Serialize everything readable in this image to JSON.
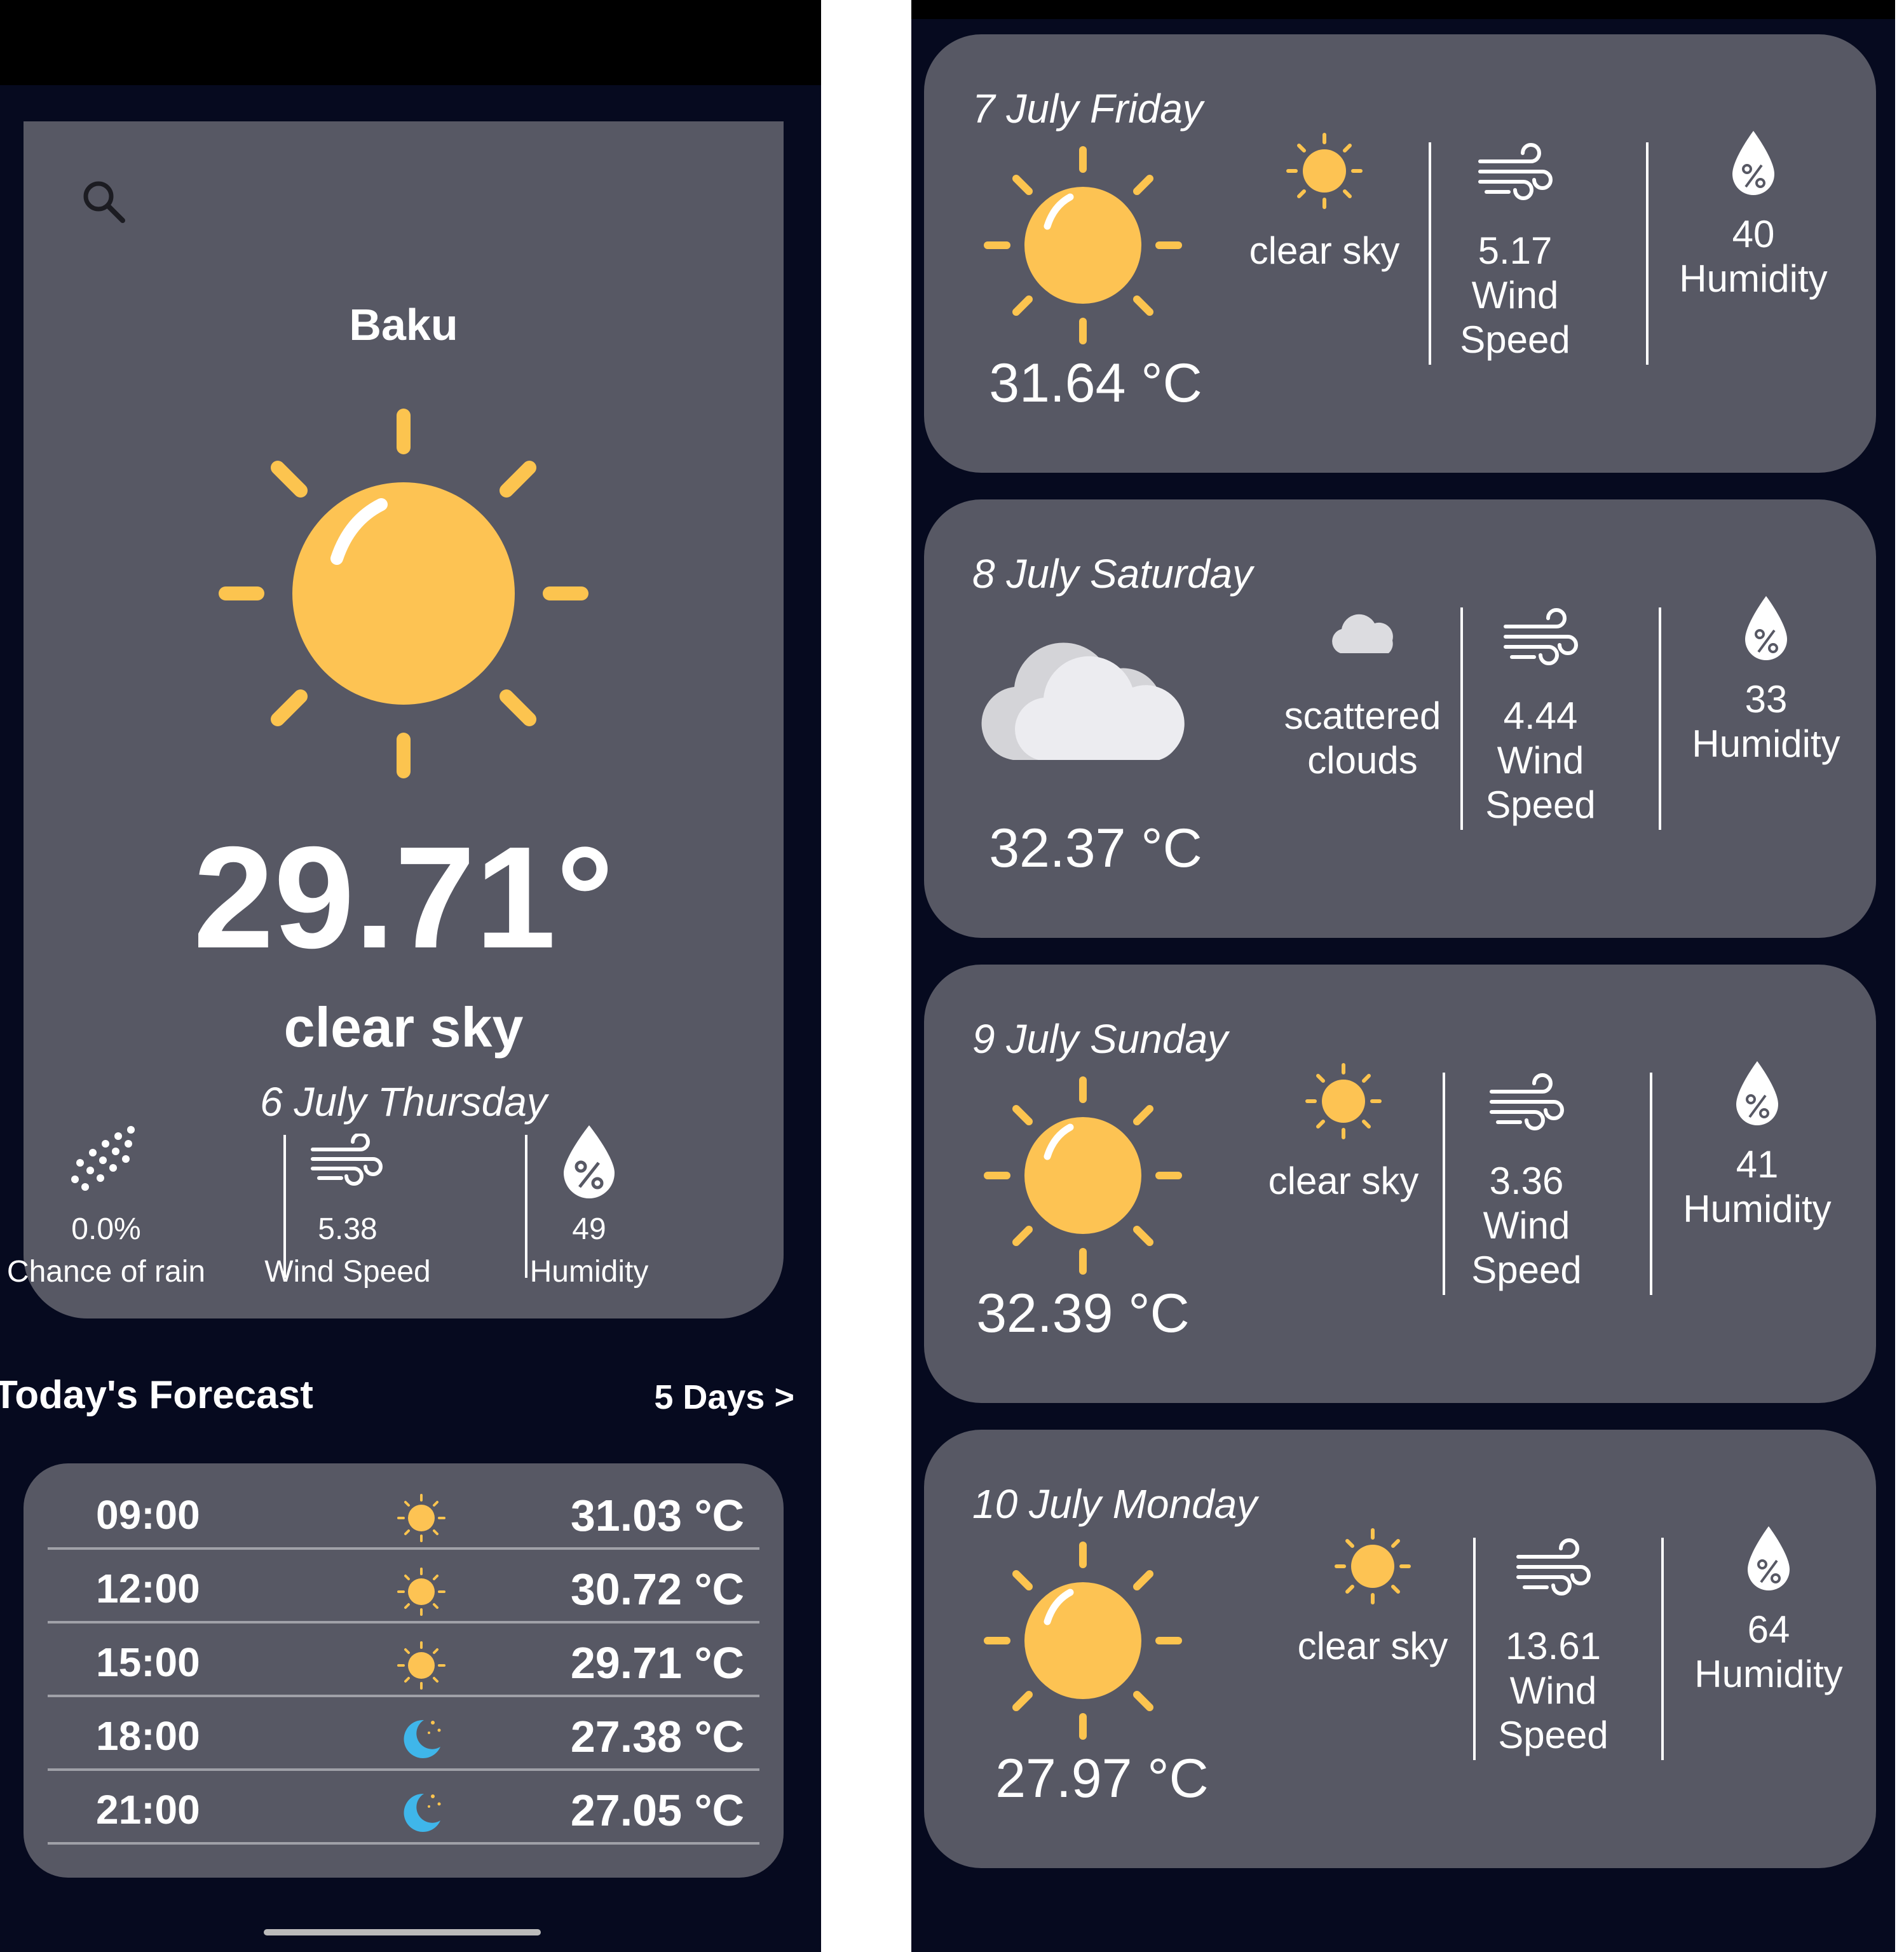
{
  "colors": {
    "background": "#060a1f",
    "card": "#575864",
    "sun": "#fcc44f",
    "sun_ray": "#fcc44f",
    "moon": "#3fb6ea",
    "text": "#ffffff"
  },
  "main": {
    "search_icon": "search-icon",
    "city": "Baku",
    "temperature": "29.71°",
    "description": "clear sky",
    "date": "6 July Thursday",
    "stats": [
      {
        "icon": "rain-icon",
        "value": "0.0%",
        "label": "Chance of rain"
      },
      {
        "icon": "wind-icon",
        "value": "5.38",
        "label": "Wind Speed"
      },
      {
        "icon": "humidity-icon",
        "value": "49",
        "label": "Humidity"
      }
    ]
  },
  "forecast": {
    "title": "Today's Forecast",
    "five_days_link": "5 Days >",
    "hours": [
      {
        "time": "09:00",
        "icon": "sun-icon",
        "temp": "31.03 °C"
      },
      {
        "time": "12:00",
        "icon": "sun-icon",
        "temp": "30.72 °C"
      },
      {
        "time": "15:00",
        "icon": "sun-icon",
        "temp": "29.71 °C"
      },
      {
        "time": "18:00",
        "icon": "moon-icon",
        "temp": "27.38 °C"
      },
      {
        "time": "21:00",
        "icon": "moon-icon",
        "temp": "27.05 °C"
      }
    ]
  },
  "days": [
    {
      "date": "7 July Friday",
      "icon": "sun-icon",
      "temp": "31.64 °C",
      "desc": "clear sky",
      "wind_value": "5.17",
      "wind_label": "Wind Speed",
      "humidity_value": "40",
      "humidity_label": "Humidity"
    },
    {
      "date": "8 July Saturday",
      "icon": "cloud-icon",
      "temp": "32.37 °C",
      "desc": "scattered clouds",
      "wind_value": "4.44",
      "wind_label": "Wind Speed",
      "humidity_value": "33",
      "humidity_label": "Humidity"
    },
    {
      "date": "9 July Sunday",
      "icon": "sun-icon",
      "temp": "32.39 °C",
      "desc": "clear sky",
      "wind_value": "3.36",
      "wind_label": "Wind Speed",
      "humidity_value": "41",
      "humidity_label": "Humidity"
    },
    {
      "date": "10 July Monday",
      "icon": "sun-icon",
      "temp": "27.97 °C",
      "desc": "clear sky",
      "wind_value": "13.61",
      "wind_label": "Wind Speed",
      "humidity_value": "64",
      "humidity_label": "Humidity"
    }
  ]
}
